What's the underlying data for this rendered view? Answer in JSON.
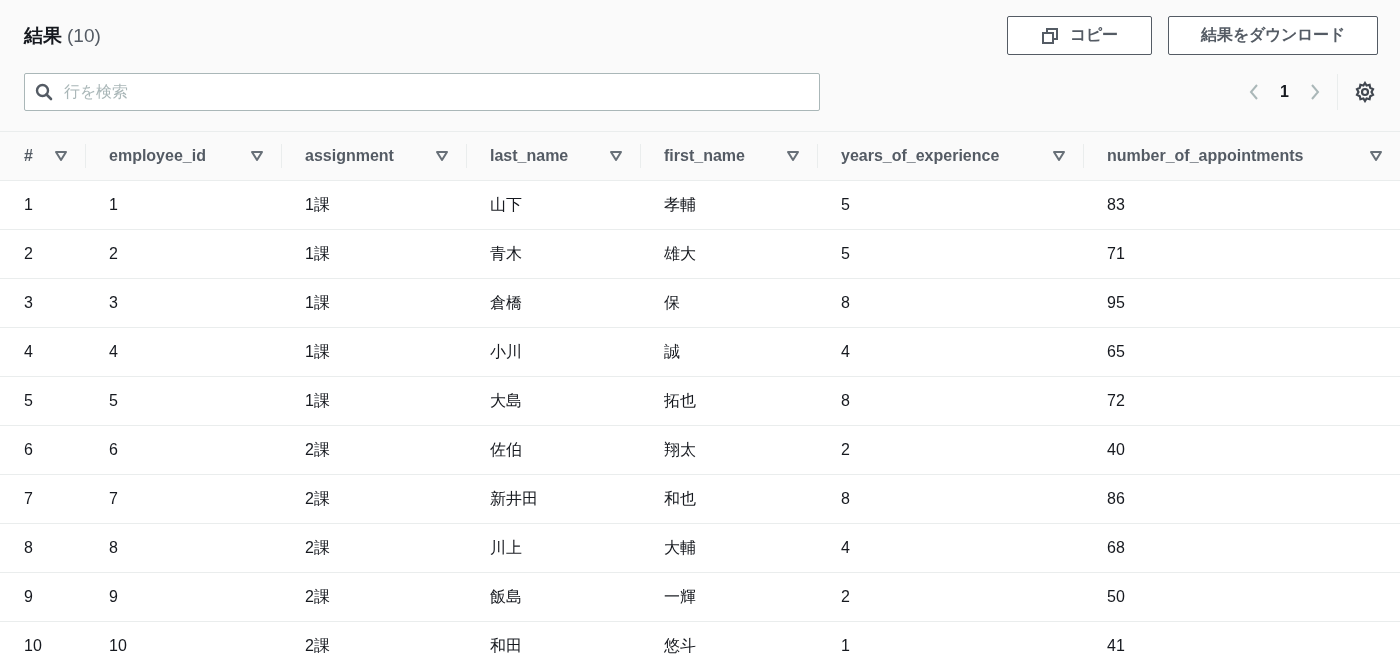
{
  "header": {
    "title": "結果",
    "count": "(10)",
    "buttons": [
      {
        "kind": "copy",
        "label": "コピー"
      },
      {
        "kind": "plain",
        "label": "結果をダウンロード"
      }
    ]
  },
  "search": {
    "placeholder": "行を検索"
  },
  "pagination": {
    "pages": [
      {
        "label": "1",
        "selected": true
      }
    ],
    "prev_disabled": true,
    "next_disabled": true
  },
  "table": {
    "columns": [
      "#",
      "employee_id",
      "assignment",
      "last_name",
      "first_name",
      "years_of_experience",
      "number_of_appointments"
    ],
    "rows": [
      [
        "1",
        "1",
        "1課",
        "山下",
        "孝輔",
        "5",
        "83"
      ],
      [
        "2",
        "2",
        "1課",
        "青木",
        "雄大",
        "5",
        "71"
      ],
      [
        "3",
        "3",
        "1課",
        "倉橋",
        "保",
        "8",
        "95"
      ],
      [
        "4",
        "4",
        "1課",
        "小川",
        "誠",
        "4",
        "65"
      ],
      [
        "5",
        "5",
        "1課",
        "大島",
        "拓也",
        "8",
        "72"
      ],
      [
        "6",
        "6",
        "2課",
        "佐伯",
        "翔太",
        "2",
        "40"
      ],
      [
        "7",
        "7",
        "2課",
        "新井田",
        "和也",
        "8",
        "86"
      ],
      [
        "8",
        "8",
        "2課",
        "川上",
        "大輔",
        "4",
        "68"
      ],
      [
        "9",
        "9",
        "2課",
        "飯島",
        "一輝",
        "2",
        "50"
      ],
      [
        "10",
        "10",
        "2課",
        "和田",
        "悠斗",
        "1",
        "41"
      ]
    ]
  }
}
